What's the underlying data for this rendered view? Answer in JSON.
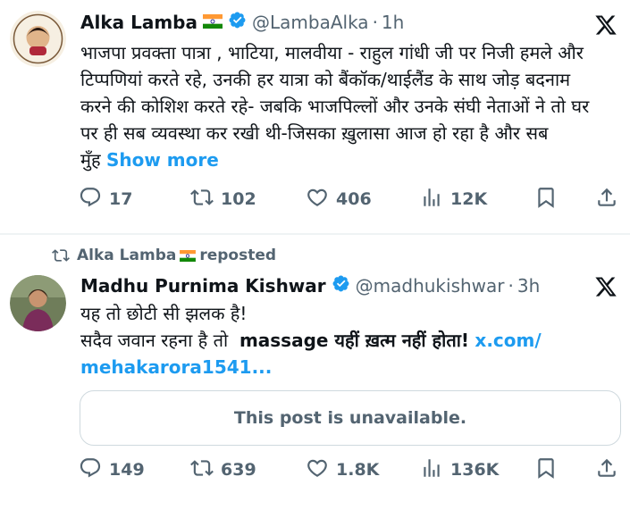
{
  "post1": {
    "author_name": "Alka Lamba",
    "author_handle": "@LambaAlka",
    "separator": "·",
    "time": "1h",
    "text_lines": [
      "भाजपा प्रवक्ता पात्रा , भाटिया, मालवीया - राहुल गांधी जी पर निजी हमले और",
      "टिप्पणियां करते रहे, उनकी हर यात्रा को बैंकॉक/थाईलैंड के साथ जोड़ बदनाम",
      "करने की कोशिश करते रहे- जबकि भाजपिल्लों और उनके संघी नेताओं ने तो घर",
      "पर ही सब व्यवस्था कर रखी थी-जिसका ख़ुलासा आज हो रहा है और सब"
    ],
    "last_line_prefix": "मुँह",
    "show_more": "Show more",
    "stats": {
      "replies": "17",
      "reposts": "102",
      "likes": "406",
      "views": "12K"
    }
  },
  "repost": {
    "reposter": "Alka Lamba",
    "label": "reposted"
  },
  "post2": {
    "author_name": "Madhu Purnima Kishwar",
    "author_handle": "@madhukishwar",
    "separator": "·",
    "time": "3h",
    "line1": "यह तो छोटी सी झलक है!",
    "line2_prefix": "सदैव जवान रहना है तो",
    "line2_bold": "massage यहीं ख़त्म नहीं होता!",
    "line2_link": "x.com/",
    "line3_link": "mehakarora1541...",
    "unavailable": "This post is unavailable.",
    "stats": {
      "replies": "149",
      "reposts": "639",
      "likes": "1.8K",
      "views": "136K"
    }
  },
  "colors": {
    "text": "#0f1419",
    "secondary": "#536471",
    "link": "#1d9bf0",
    "verified": "#1d9bf0",
    "border": "#cfd9de"
  },
  "icons": [
    "reply-icon",
    "repost-icon",
    "like-icon",
    "views-icon",
    "bookmark-icon",
    "share-icon",
    "x-logo-icon",
    "verified-badge-icon",
    "india-flag-icon"
  ]
}
